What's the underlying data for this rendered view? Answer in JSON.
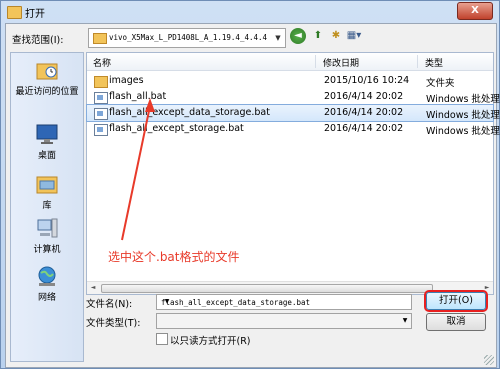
{
  "window": {
    "title": "打开",
    "close_label": "X"
  },
  "toolbar": {
    "lookin_label": "查找范围(I):",
    "lookin_value": "vivo_X5Max_L_PD1408L_A_1.19.4_4.4.4"
  },
  "places": [
    {
      "label": "最近访问的位置",
      "icon": "recent-places-icon"
    },
    {
      "label": "桌面",
      "icon": "desktop-icon"
    },
    {
      "label": "库",
      "icon": "library-icon"
    },
    {
      "label": "计算机",
      "icon": "computer-icon"
    },
    {
      "label": "网络",
      "icon": "network-icon"
    }
  ],
  "columns": {
    "name": "名称",
    "date": "修改日期",
    "type": "类型"
  },
  "files": [
    {
      "name": "images",
      "date": "2015/10/16 10:24",
      "type": "文件夹",
      "kind": "folder"
    },
    {
      "name": "flash_all.bat",
      "date": "2016/4/14 20:02",
      "type": "Windows 批处理文",
      "kind": "bat"
    },
    {
      "name": "flash_all_except_data_storage.bat",
      "date": "2016/4/14 20:02",
      "type": "Windows 批处理文",
      "kind": "bat",
      "selected": true
    },
    {
      "name": "flash_all_except_storage.bat",
      "date": "2016/4/14 20:02",
      "type": "Windows 批处理文",
      "kind": "bat"
    }
  ],
  "annotation": "选中这个.bat格式的文件",
  "form": {
    "filename_label": "文件名(N):",
    "filename_value": "flash_all_except_data_storage.bat",
    "filetype_label": "文件类型(T):",
    "filetype_value": "",
    "readonly_label": "以只读方式打开(R)"
  },
  "buttons": {
    "open": "打开(O)",
    "cancel": "取消"
  },
  "colors": {
    "annotation": "#e83a2a",
    "selection": "#d4e7fb",
    "highlight_box": "#e82020"
  }
}
